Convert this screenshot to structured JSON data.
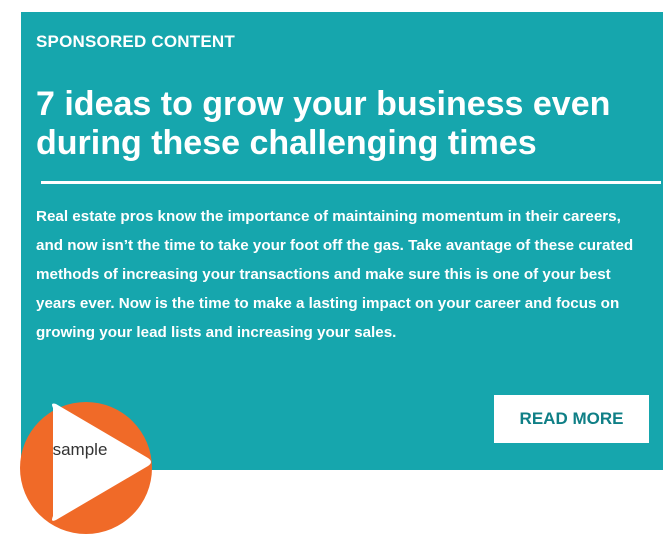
{
  "ad": {
    "eyebrow": "SPONSORED CONTENT",
    "headline": "7 ideas to grow your business even during these challenging times",
    "body": "Real estate pros know the importance of maintaining momentum in their careers, and now isn’t the time to take your foot off the gas. Take avantage of these curated methods of increasing your transactions and make sure this is one of your best years ever.  Now is the time to make a lasting impact on your career and focus on growing your lead lists and increasing your sales.",
    "cta_label": "READ MORE"
  },
  "badge": {
    "label": "sample",
    "icon": "play-icon"
  },
  "colors": {
    "card_background": "#16a6ad",
    "badge_orange": "#f06a28",
    "text_white": "#ffffff"
  }
}
